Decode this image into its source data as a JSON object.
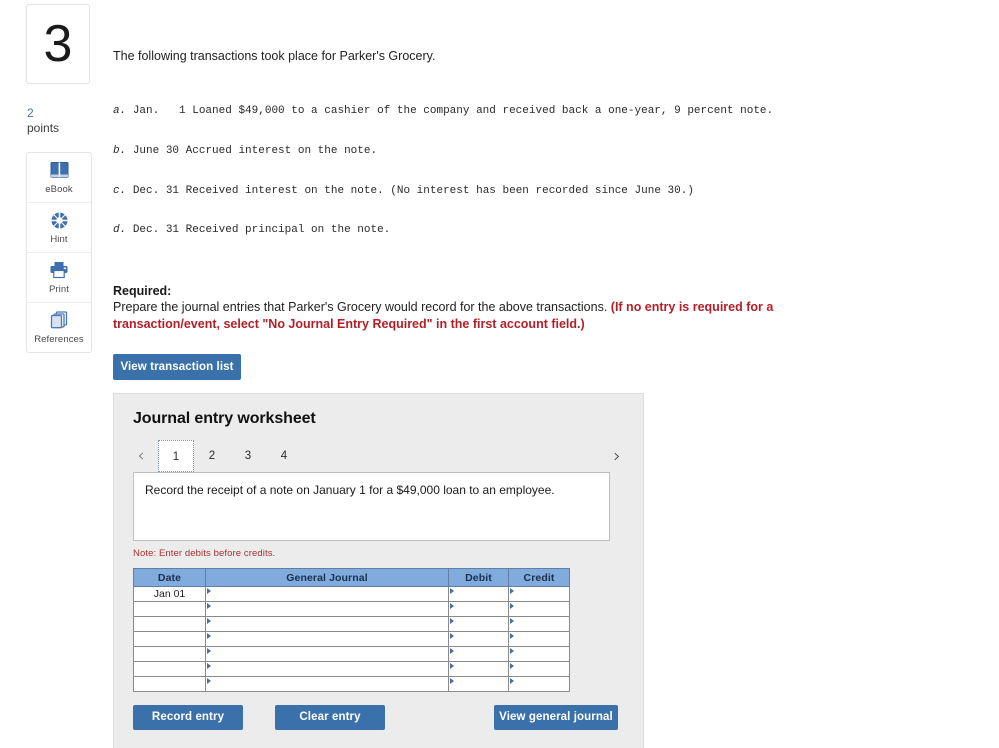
{
  "question": {
    "number": "3",
    "points_value": "2",
    "points_label": "points"
  },
  "tools": [
    {
      "label": "eBook",
      "icon": "book-icon"
    },
    {
      "label": "Hint",
      "icon": "life-ring-icon"
    },
    {
      "label": "Print",
      "icon": "printer-icon"
    },
    {
      "label": "References",
      "icon": "references-icon"
    }
  ],
  "content": {
    "intro": "The following transactions took place for Parker's Grocery.",
    "transactions": [
      {
        "label": "a.",
        "date": "Jan.   1",
        "text": "Loaned $49,000 to a cashier of the company and received back a one-year, 9 percent note."
      },
      {
        "label": "b.",
        "date": "June 30",
        "text": "Accrued interest on the note."
      },
      {
        "label": "c.",
        "date": "Dec. 31",
        "text": "Received interest on the note. (No interest has been recorded since June 30.)"
      },
      {
        "label": "d.",
        "date": "Dec. 31",
        "text": "Received principal on the note."
      }
    ],
    "required_title": "Required:",
    "required_body": "Prepare the journal entries that Parker's Grocery would record for the above transactions. ",
    "required_red": "(If no entry is required for a transaction/event, select \"No Journal Entry Required\" in the first account field.)",
    "view_transaction_list": "View transaction list"
  },
  "worksheet": {
    "title": "Journal entry worksheet",
    "prev_arrow": "‹",
    "next_arrow": "›",
    "tabs": [
      {
        "label": "1",
        "active": true
      },
      {
        "label": "2",
        "active": false
      },
      {
        "label": "3",
        "active": false
      },
      {
        "label": "4",
        "active": false
      }
    ],
    "prompt": "Record the receipt of a note on January 1 for a $49,000 loan to an employee.",
    "note": "Note: Enter debits before credits.",
    "table": {
      "headers": [
        "Date",
        "General Journal",
        "Debit",
        "Credit"
      ],
      "rows": [
        {
          "date": "Jan 01",
          "general_journal": "",
          "debit": "",
          "credit": ""
        },
        {
          "date": "",
          "general_journal": "",
          "debit": "",
          "credit": ""
        },
        {
          "date": "",
          "general_journal": "",
          "debit": "",
          "credit": ""
        },
        {
          "date": "",
          "general_journal": "",
          "debit": "",
          "credit": ""
        },
        {
          "date": "",
          "general_journal": "",
          "debit": "",
          "credit": ""
        },
        {
          "date": "",
          "general_journal": "",
          "debit": "",
          "credit": ""
        },
        {
          "date": "",
          "general_journal": "",
          "debit": "",
          "credit": ""
        }
      ]
    },
    "actions": {
      "record_entry": "Record entry",
      "clear_entry": "Clear entry",
      "view_general_journal": "View general journal"
    }
  },
  "colors": {
    "button_blue": "#3a71ab",
    "table_header_blue": "#81aadd",
    "alert_red": "#b41f27",
    "note_red": "#a8312f",
    "panel_gray": "#ececec"
  }
}
